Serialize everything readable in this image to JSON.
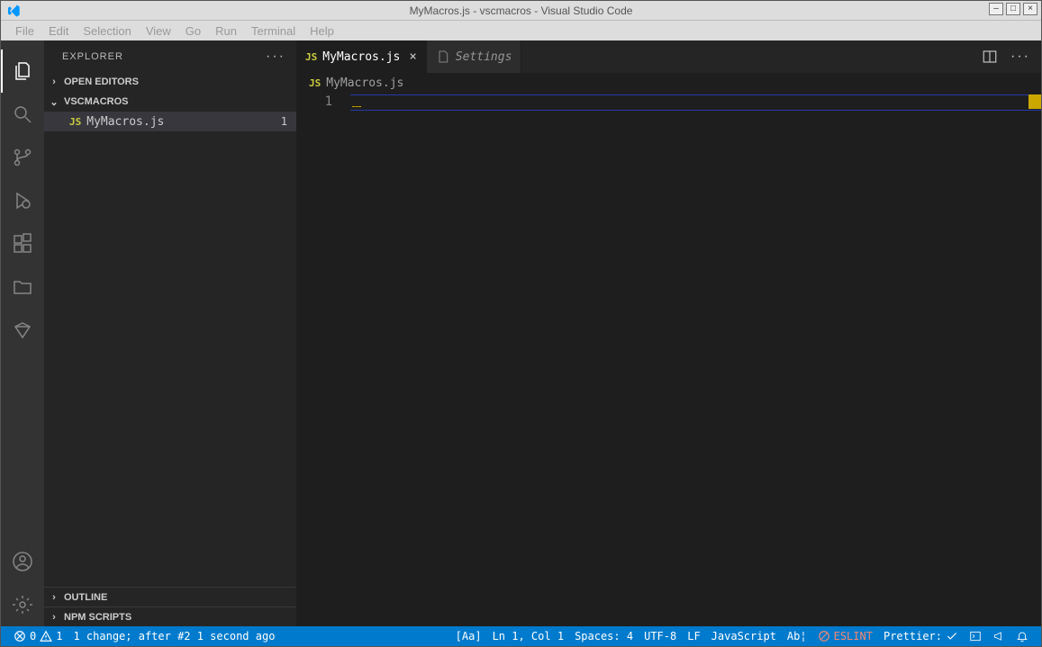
{
  "window": {
    "title": "MyMacros.js - vscmacros - Visual Studio Code"
  },
  "menu": {
    "items": [
      "File",
      "Edit",
      "Selection",
      "View",
      "Go",
      "Run",
      "Terminal",
      "Help"
    ]
  },
  "sidebar": {
    "title": "EXPLORER",
    "sections": {
      "open_editors": "OPEN EDITORS",
      "workspace": "VSCMACROS",
      "outline": "OUTLINE",
      "npm": "NPM SCRIPTS"
    },
    "file": {
      "badge": "JS",
      "name": "MyMacros.js",
      "problems": "1"
    }
  },
  "tabs": {
    "active": {
      "badge": "JS",
      "label": "MyMacros.js"
    },
    "inactive": {
      "label": "Settings"
    }
  },
  "breadcrumb": {
    "badge": "JS",
    "label": "MyMacros.js"
  },
  "editor": {
    "line_number": "1"
  },
  "statusbar": {
    "errors": "0",
    "warnings": "1",
    "scm": "1 change; after #2  1 second ago",
    "case": "[Aa]",
    "cursor": "Ln 1, Col 1",
    "spaces": "Spaces: 4",
    "encoding": "UTF-8",
    "eol": "LF",
    "language": "JavaScript",
    "tabmode": "Ab¦",
    "eslint": "ESLINT",
    "prettier": "Prettier:"
  }
}
